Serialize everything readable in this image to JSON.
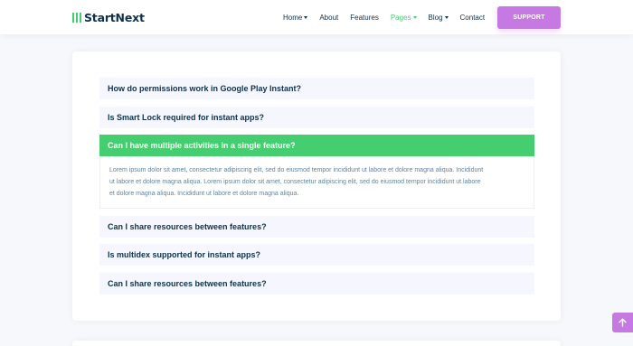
{
  "header": {
    "logo_text": "StartNext",
    "nav": [
      {
        "label": "Home",
        "dropdown": true,
        "active": false
      },
      {
        "label": "About",
        "dropdown": false,
        "active": false
      },
      {
        "label": "Features",
        "dropdown": false,
        "active": false
      },
      {
        "label": "Pages",
        "dropdown": true,
        "active": true
      },
      {
        "label": "Blog",
        "dropdown": true,
        "active": false
      },
      {
        "label": "Contact",
        "dropdown": false,
        "active": false
      }
    ],
    "support_label": "SUPPORT"
  },
  "faq": {
    "items": [
      {
        "question": "How do permissions work in Google Play Instant?",
        "open": false
      },
      {
        "question": "Is Smart Lock required for instant apps?",
        "open": false
      },
      {
        "question": "Can I have multiple activities in a single feature?",
        "open": true
      },
      {
        "question": "Can I share resources between features?",
        "open": false
      },
      {
        "question": "Is multidex supported for instant apps?",
        "open": false
      },
      {
        "question": "Can I share resources between features?",
        "open": false
      }
    ],
    "answer_lines": [
      "Lorem ipsum dolor sit amet, consectetur adipiscing elit, sed do eiusmod tempor incididunt ut labore et dolore magna aliqua. Incididunt",
      "ut labore et dolore magna aliqua. Lorem ipsum dolor sit amet, consectetur adipiscing elit, sed do eiusmod tempor incididunt ut labore",
      "et dolore magna aliqua. Incididunt ut labore et dolore magna aliqua."
    ]
  },
  "colors": {
    "accent_green": "#44ce6f",
    "accent_purple": "#c679e3",
    "navy": "#0e314c",
    "question_bg": "#f6f7fe"
  },
  "icons": {
    "back_to_top": "arrow-up-icon"
  }
}
